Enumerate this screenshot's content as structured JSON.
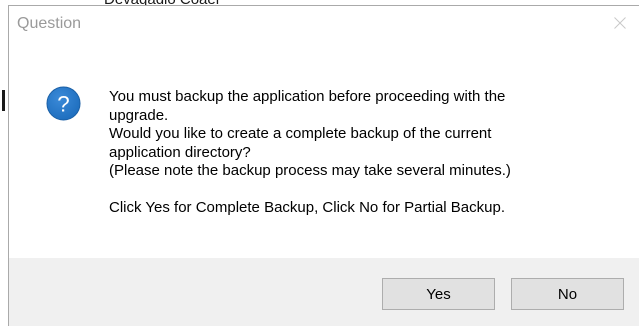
{
  "background_window": {
    "partial_text": "Devaqadio Coaer"
  },
  "dialog": {
    "title": "Question",
    "close_icon": "close-icon",
    "icon": "question-icon",
    "colors": {
      "icon_fill": "#1f6fbf",
      "footer_bg": "#f0f0f0",
      "button_bg": "#e1e1e1"
    },
    "message": {
      "line1": "You must backup the application before proceeding with the",
      "line2": "upgrade.",
      "line3": "Would you like to create a complete backup of the current",
      "line4": "application directory?",
      "line5": "(Please note the backup process may take several minutes.)",
      "line6": "Click Yes for Complete Backup, Click No for Partial Backup."
    },
    "buttons": {
      "yes": "Yes",
      "no": "No"
    }
  }
}
